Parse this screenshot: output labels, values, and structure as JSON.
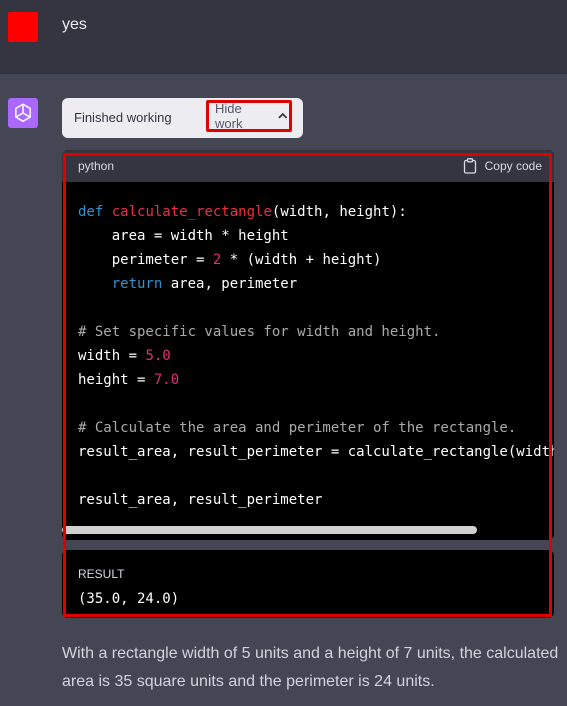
{
  "user": {
    "message": "yes"
  },
  "work_status": {
    "label": "Finished working",
    "toggle_label": "Hide work"
  },
  "code": {
    "language": "python",
    "copy_label": "Copy code"
  },
  "result": {
    "label": "RESULT",
    "value": "(35.0, 24.0)"
  },
  "answer": "With a rectangle width of 5 units and a height of 7 units, the calculated area is 35 square units and the perimeter is 24 units.",
  "colors": {
    "highlight": "#e00000",
    "user_avatar": "#ff0000",
    "assistant_avatar": "#ab68ff"
  }
}
